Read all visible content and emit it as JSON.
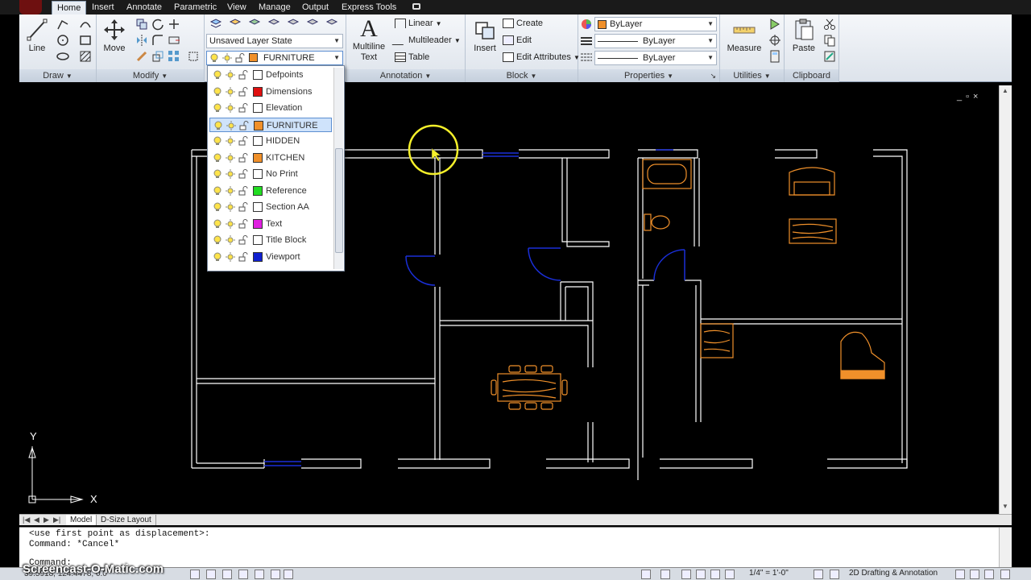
{
  "ribbon_tabs": [
    {
      "label": "Home",
      "active": true
    },
    {
      "label": "Insert"
    },
    {
      "label": "Annotate"
    },
    {
      "label": "Parametric"
    },
    {
      "label": "View"
    },
    {
      "label": "Manage"
    },
    {
      "label": "Output"
    },
    {
      "label": "Express Tools"
    }
  ],
  "panels": {
    "draw": {
      "title": "Draw",
      "line_label": "Line"
    },
    "modify": {
      "title": "Modify",
      "move_label": "Move"
    },
    "layers": {
      "layer_state": "Unsaved Layer State",
      "current_layer": "FURNITURE",
      "current_color": "#f0902a"
    },
    "annotation": {
      "title": "Annotation",
      "multiline_text_line1": "Multiline",
      "multiline_text_line2": "Text",
      "linear_label": "Linear",
      "multileader_label": "Multileader",
      "table_label": "Table"
    },
    "block": {
      "title": "Block",
      "insert_label": "Insert",
      "create_label": "Create",
      "edit_label": "Edit",
      "edit_attributes_label": "Edit Attributes"
    },
    "properties": {
      "title": "Properties",
      "color_value": "ByLayer",
      "linetype_value": "ByLayer",
      "lineweight_value": "ByLayer"
    },
    "utilities": {
      "title": "Utilities",
      "measure_label": "Measure"
    },
    "clipboard": {
      "title": "Clipboard",
      "paste_label": "Paste"
    }
  },
  "layer_dropdown": [
    {
      "name": "Defpoints",
      "color": "#ffffff"
    },
    {
      "name": "Dimensions",
      "color": "#e01010"
    },
    {
      "name": "Elevation",
      "color": "#ffffff"
    },
    {
      "name": "FURNITURE",
      "color": "#f0902a",
      "selected": true
    },
    {
      "name": "HIDDEN",
      "color": "#ffffff"
    },
    {
      "name": "KITCHEN",
      "color": "#f0902a"
    },
    {
      "name": "No Print",
      "color": "#ffffff"
    },
    {
      "name": "Reference",
      "color": "#22dd22"
    },
    {
      "name": "Section AA",
      "color": "#ffffff"
    },
    {
      "name": "Text",
      "color": "#e020e0"
    },
    {
      "name": "Title Block",
      "color": "#ffffff"
    },
    {
      "name": "Viewport",
      "color": "#1020d0"
    }
  ],
  "canvas": {
    "ucs_x_label": "X",
    "ucs_y_label": "Y"
  },
  "layout_tabs": [
    {
      "label": "Model",
      "active": true
    },
    {
      "label": "D-Size Layout"
    }
  ],
  "command_history": [
    "<use first point as displacement>:",
    "Command: *Cancel*",
    "Command:"
  ],
  "status": {
    "coordinates": "39.5918, 124.4478, 0.0",
    "annotation_scale": "1/4\" = 1'-0\"",
    "workspace": "2D Drafting & Annotation"
  },
  "watermark": "Screencast-O-Matic.com",
  "colors": {
    "furniture": "#f0902a",
    "doors": "#1a2fd8",
    "walls": "#ffffff",
    "cursor_ring": "#f5f02a"
  }
}
